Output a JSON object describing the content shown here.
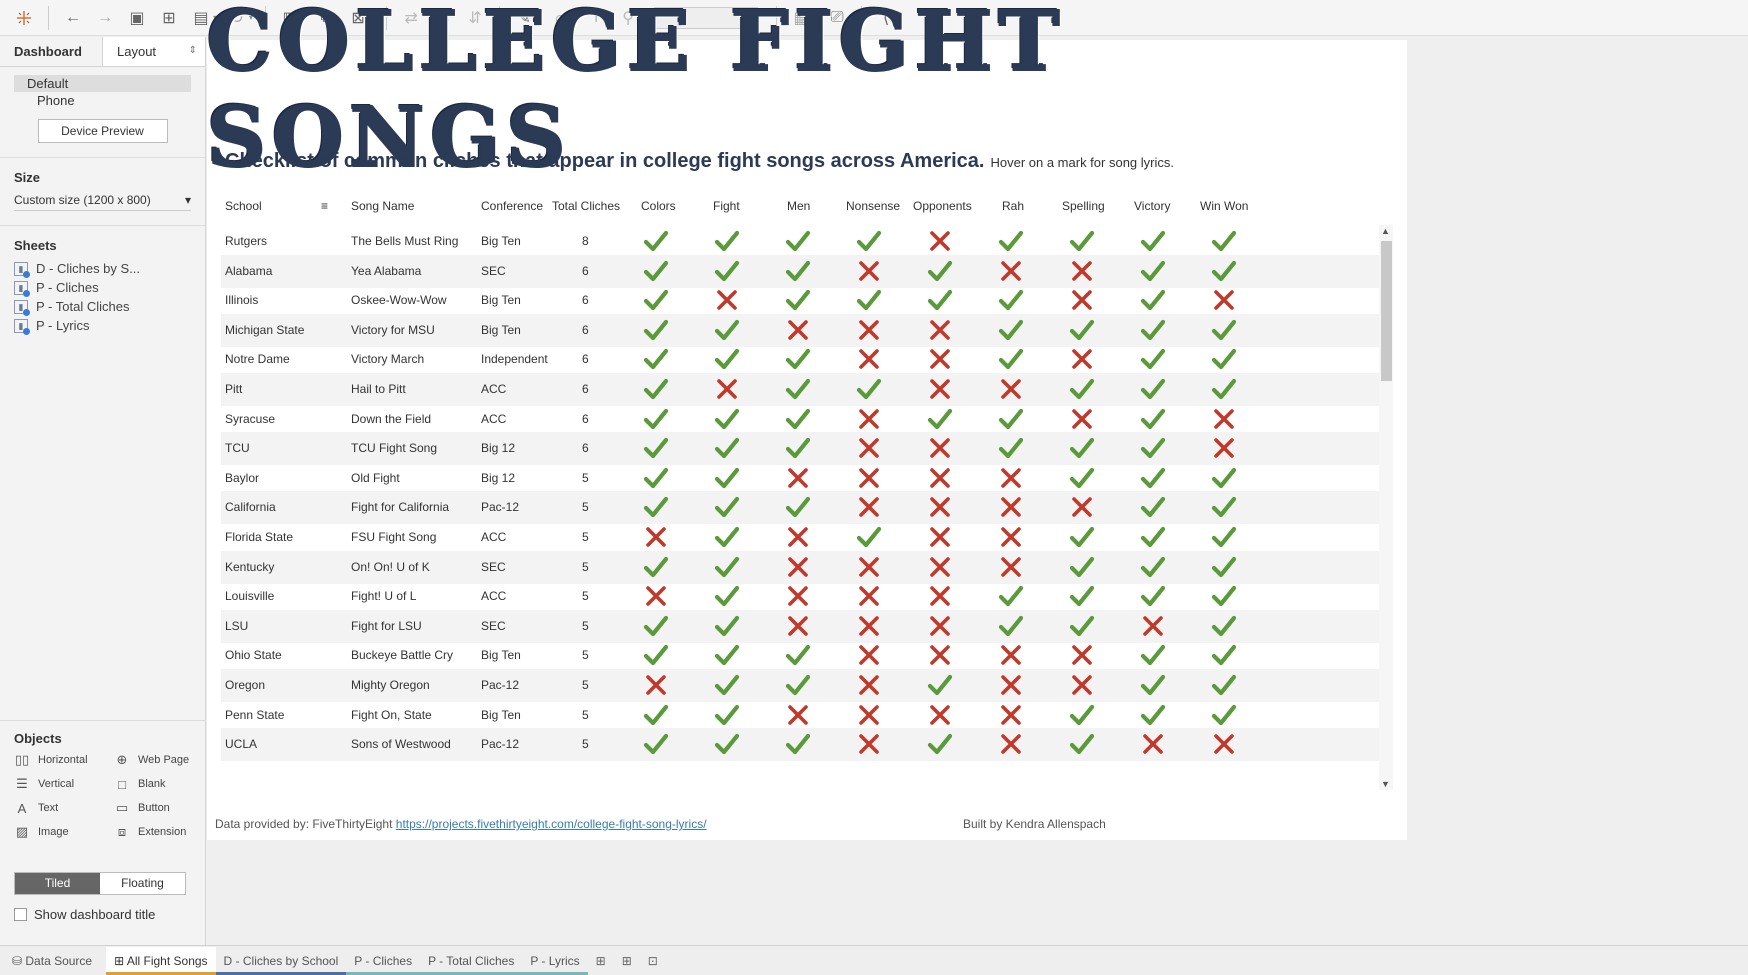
{
  "left_panel": {
    "tabs": [
      "Dashboard",
      "Layout"
    ],
    "devices": [
      "Default",
      "Phone"
    ],
    "device_preview_label": "Device Preview",
    "size_heading": "Size",
    "size_value": "Custom size (1200 x 800)",
    "sheets_heading": "Sheets",
    "sheets": [
      "D - Cliches by S...",
      "P - Cliches",
      "P - Total Cliches",
      "P - Lyrics"
    ],
    "objects_heading": "Objects",
    "objects": [
      {
        "label": "Horizontal",
        "icon": "horizontal-icon"
      },
      {
        "label": "Web Page",
        "icon": "globe-icon"
      },
      {
        "label": "Vertical",
        "icon": "vertical-icon"
      },
      {
        "label": "Blank",
        "icon": "blank-icon"
      },
      {
        "label": "Text",
        "icon": "text-icon"
      },
      {
        "label": "Button",
        "icon": "button-icon"
      },
      {
        "label": "Image",
        "icon": "image-icon"
      },
      {
        "label": "Extension",
        "icon": "extension-icon"
      }
    ],
    "tiled_label": "Tiled",
    "floating_label": "Floating",
    "show_title_label": "Show dashboard title"
  },
  "dashboard": {
    "title": "COLLEGE FIGHT SONGS",
    "subtitle": "Checklist of common cliches that appear in college fight songs across America.",
    "subtitle_hint": "Hover on a mark for song lyrics.",
    "columns": [
      "School",
      "Song Name",
      "Conference",
      "Total Cliches",
      "Colors",
      "Fight",
      "Men",
      "Nonsense",
      "Opponents",
      "Rah",
      "Spelling",
      "Victory",
      "Win Won"
    ],
    "rows": [
      {
        "school": "Rutgers",
        "song": "The Bells Must Ring",
        "conf": "Big Ten",
        "total": "8",
        "marks": [
          1,
          1,
          1,
          1,
          0,
          1,
          1,
          1,
          1
        ]
      },
      {
        "school": "Alabama",
        "song": "Yea Alabama",
        "conf": "SEC",
        "total": "6",
        "marks": [
          1,
          1,
          1,
          0,
          1,
          0,
          0,
          1,
          1
        ]
      },
      {
        "school": "Illinois",
        "song": "Oskee-Wow-Wow",
        "conf": "Big Ten",
        "total": "6",
        "marks": [
          1,
          0,
          1,
          1,
          1,
          1,
          0,
          1,
          0
        ]
      },
      {
        "school": "Michigan State",
        "song": "Victory for MSU",
        "conf": "Big Ten",
        "total": "6",
        "marks": [
          1,
          1,
          0,
          0,
          0,
          1,
          1,
          1,
          1
        ]
      },
      {
        "school": "Notre Dame",
        "song": "Victory March",
        "conf": "Independent",
        "total": "6",
        "marks": [
          1,
          1,
          1,
          0,
          0,
          1,
          0,
          1,
          1
        ]
      },
      {
        "school": "Pitt",
        "song": "Hail to Pitt",
        "conf": "ACC",
        "total": "6",
        "marks": [
          1,
          0,
          1,
          1,
          0,
          0,
          1,
          1,
          1
        ]
      },
      {
        "school": "Syracuse",
        "song": "Down the Field",
        "conf": "ACC",
        "total": "6",
        "marks": [
          1,
          1,
          1,
          0,
          1,
          1,
          0,
          1,
          0
        ]
      },
      {
        "school": "TCU",
        "song": "TCU Fight Song",
        "conf": "Big 12",
        "total": "6",
        "marks": [
          1,
          1,
          1,
          0,
          0,
          1,
          1,
          1,
          0
        ]
      },
      {
        "school": "Baylor",
        "song": "Old Fight",
        "conf": "Big 12",
        "total": "5",
        "marks": [
          1,
          1,
          0,
          0,
          0,
          0,
          1,
          1,
          1
        ]
      },
      {
        "school": "California",
        "song": "Fight for California",
        "conf": "Pac-12",
        "total": "5",
        "marks": [
          1,
          1,
          1,
          0,
          0,
          0,
          0,
          1,
          1
        ]
      },
      {
        "school": "Florida State",
        "song": "FSU Fight Song",
        "conf": "ACC",
        "total": "5",
        "marks": [
          0,
          1,
          0,
          1,
          0,
          0,
          1,
          1,
          1
        ]
      },
      {
        "school": "Kentucky",
        "song": "On! On! U of K",
        "conf": "SEC",
        "total": "5",
        "marks": [
          1,
          1,
          0,
          0,
          0,
          0,
          1,
          1,
          1
        ]
      },
      {
        "school": "Louisville",
        "song": "Fight! U of L",
        "conf": "ACC",
        "total": "5",
        "marks": [
          0,
          1,
          0,
          0,
          0,
          1,
          1,
          1,
          1
        ]
      },
      {
        "school": "LSU",
        "song": "Fight for LSU",
        "conf": "SEC",
        "total": "5",
        "marks": [
          1,
          1,
          0,
          0,
          0,
          1,
          1,
          0,
          1
        ]
      },
      {
        "school": "Ohio State",
        "song": "Buckeye Battle Cry",
        "conf": "Big Ten",
        "total": "5",
        "marks": [
          1,
          1,
          1,
          0,
          0,
          0,
          0,
          1,
          1
        ]
      },
      {
        "school": "Oregon",
        "song": "Mighty Oregon",
        "conf": "Pac-12",
        "total": "5",
        "marks": [
          0,
          1,
          1,
          0,
          1,
          0,
          0,
          1,
          1
        ]
      },
      {
        "school": "Penn State",
        "song": "Fight On, State",
        "conf": "Big Ten",
        "total": "5",
        "marks": [
          1,
          1,
          0,
          0,
          0,
          0,
          1,
          1,
          1
        ]
      },
      {
        "school": "UCLA",
        "song": "Sons of Westwood",
        "conf": "Pac-12",
        "total": "5",
        "marks": [
          1,
          1,
          1,
          0,
          1,
          0,
          1,
          0,
          0
        ]
      }
    ],
    "footer_source": "Data provided by: FiveThirtyEight",
    "footer_link": "https://projects.fivethirtyeight.com/college-fight-song-lyrics/",
    "footer_credit": "Built by Kendra Allenspach"
  },
  "bottom_tabs": [
    {
      "label": "Data Source",
      "color": ""
    },
    {
      "label": "All Fight Songs",
      "color": "orange",
      "active": true
    },
    {
      "label": "D - Cliches by School",
      "color": "blue"
    },
    {
      "label": "P - Cliches",
      "color": "teal"
    },
    {
      "label": "P - Total Cliches",
      "color": "teal"
    },
    {
      "label": "P - Lyrics",
      "color": "teal"
    }
  ],
  "colors": {
    "check": "#5a9a3a",
    "cross": "#c0392b",
    "title": "#2b3a55"
  }
}
